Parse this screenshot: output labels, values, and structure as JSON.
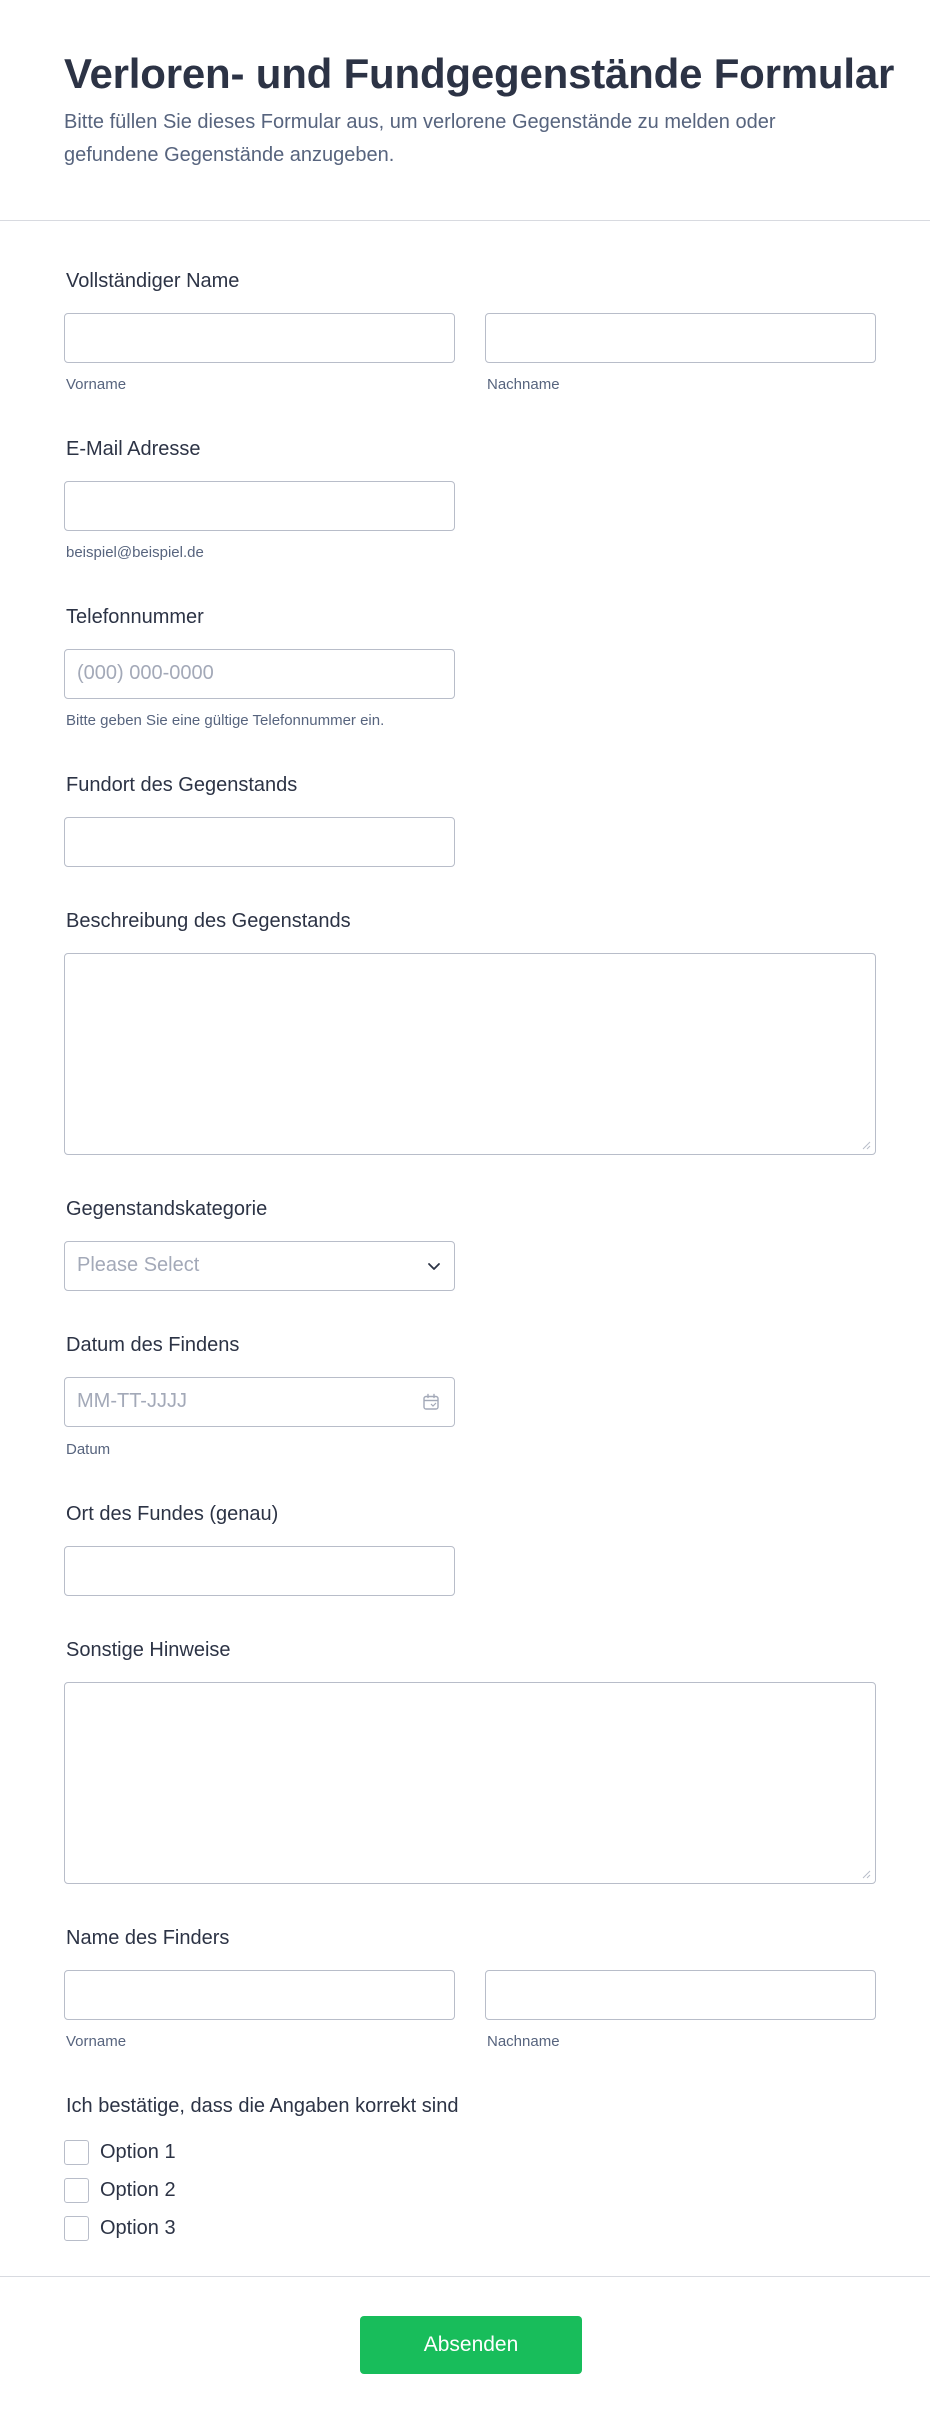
{
  "form": {
    "title": "Verloren- und Fundgegenstände Formular",
    "subtitle": "Bitte füllen Sie dieses Formular aus, um verlorene Gegenstände zu melden oder gefundene Gegenstände anzugeben."
  },
  "fields": {
    "full_name": {
      "label": "Vollständiger Name",
      "first_sublabel": "Vorname",
      "last_sublabel": "Nachname",
      "first_value": "",
      "last_value": ""
    },
    "email": {
      "label": "E-Mail Adresse",
      "sublabel": "beispiel@beispiel.de",
      "value": ""
    },
    "phone": {
      "label": "Telefonnummer",
      "placeholder": "(000) 000-0000",
      "sublabel": "Bitte geben Sie eine gültige Telefonnummer ein.",
      "value": ""
    },
    "item_location": {
      "label": "Fundort des Gegenstands",
      "value": ""
    },
    "item_description": {
      "label": "Beschreibung des Gegenstands",
      "value": ""
    },
    "item_category": {
      "label": "Gegenstandskategorie",
      "placeholder": "Please Select",
      "selected": ""
    },
    "found_date": {
      "label": "Datum des Findens",
      "placeholder": "MM-TT-JJJJ",
      "sublabel": "Datum",
      "value": ""
    },
    "found_place": {
      "label": "Ort des Fundes (genau)",
      "value": ""
    },
    "notes": {
      "label": "Sonstige Hinweise",
      "value": ""
    },
    "finder_name": {
      "label": "Name des Finders",
      "first_sublabel": "Vorname",
      "last_sublabel": "Nachname",
      "first_value": "",
      "last_value": ""
    },
    "confirmation": {
      "label": "Ich bestätige, dass die Angaben korrekt sind",
      "options": [
        "Option 1",
        "Option 2",
        "Option 3"
      ]
    }
  },
  "submit": {
    "label": "Absenden"
  },
  "icons": {
    "select": "chevron-down-icon",
    "date": "calendar-icon",
    "resize": "resize-grip-icon"
  },
  "colors": {
    "accent": "#18bd5b",
    "text": "#2c3345",
    "muted": "#57647e",
    "border": "#b8bdc9",
    "placeholder": "#a3a9b8"
  }
}
